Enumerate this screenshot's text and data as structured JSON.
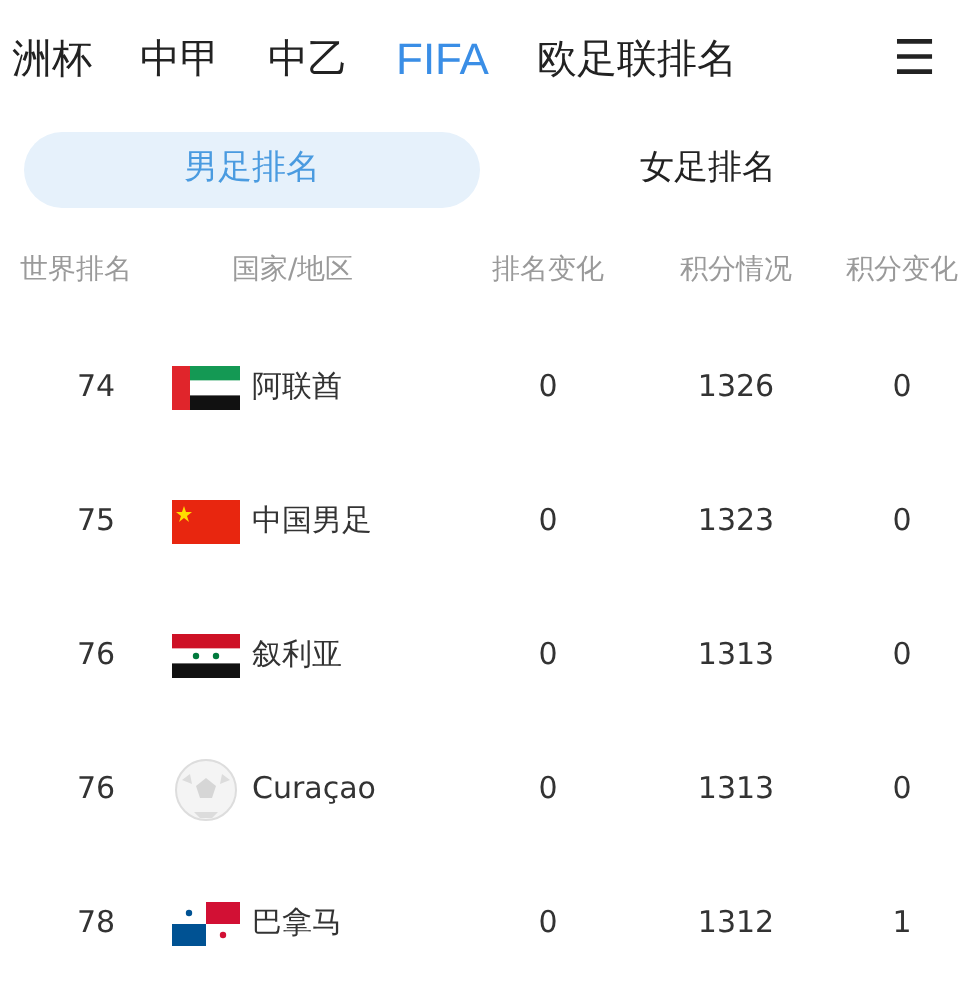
{
  "nav_tabs": [
    {
      "label": "洲杯",
      "selected": false
    },
    {
      "label": "中甲",
      "selected": false
    },
    {
      "label": "中乙",
      "selected": false
    },
    {
      "label": "FIFA",
      "selected": true
    },
    {
      "label": "欧足联排名",
      "selected": false
    }
  ],
  "menu_icon": "☰",
  "segments": [
    {
      "label": "男足排名",
      "selected": true
    },
    {
      "label": "女足排名",
      "selected": false
    }
  ],
  "table": {
    "columns": [
      "世界排名",
      "国家/地区",
      "排名变化",
      "积分情况",
      "积分变化"
    ],
    "rows": [
      {
        "rank": "74",
        "kind": "uae",
        "country": "阿联酋",
        "rank_change": "0",
        "points": "1326",
        "points_change": "0"
      },
      {
        "rank": "75",
        "kind": "china",
        "country": "中国男足",
        "rank_change": "0",
        "points": "1323",
        "points_change": "0"
      },
      {
        "rank": "76",
        "kind": "syria",
        "country": "叙利亚",
        "rank_change": "0",
        "points": "1313",
        "points_change": "0"
      },
      {
        "rank": "76",
        "kind": "ball",
        "country": "Curaçao",
        "rank_change": "0",
        "points": "1313",
        "points_change": "0"
      },
      {
        "rank": "78",
        "kind": "panama",
        "country": "巴拿马",
        "rank_change": "0",
        "points": "1312",
        "points_change": "1"
      }
    ]
  }
}
